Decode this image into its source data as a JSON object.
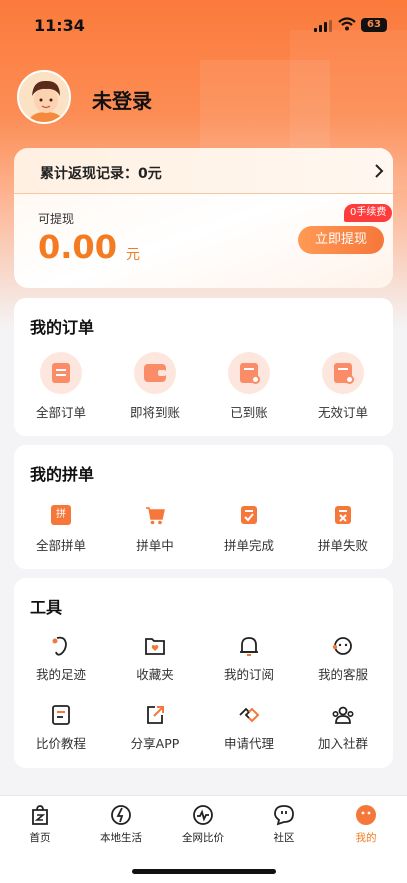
{
  "status_bar": {
    "time": "11:34",
    "battery": "63"
  },
  "user": {
    "name": "未登录"
  },
  "cashback": {
    "total_label": "累计返现记录：0元",
    "withdrawable_label": "可提现",
    "amount": "0.00",
    "unit": "元",
    "fee_badge": "0手续费",
    "withdraw_button": "立即提现"
  },
  "orders": {
    "title": "我的订单",
    "items": [
      {
        "label": "全部订单",
        "icon": "all-orders-icon"
      },
      {
        "label": "即将到账",
        "icon": "wallet-icon"
      },
      {
        "label": "已到账",
        "icon": "received-icon"
      },
      {
        "label": "无效订单",
        "icon": "invalid-order-icon"
      }
    ]
  },
  "pindan": {
    "title": "我的拼单",
    "items": [
      {
        "label": "全部拼单",
        "icon": "group-all-icon"
      },
      {
        "label": "拼单中",
        "icon": "cart-icon"
      },
      {
        "label": "拼单完成",
        "icon": "group-done-icon"
      },
      {
        "label": "拼单失败",
        "icon": "group-fail-icon"
      }
    ],
    "pin_glyph": "拼"
  },
  "tools": {
    "title": "工具",
    "items": [
      {
        "label": "我的足迹",
        "icon": "footprint-icon"
      },
      {
        "label": "收藏夹",
        "icon": "favorites-icon"
      },
      {
        "label": "我的订阅",
        "icon": "bell-icon"
      },
      {
        "label": "我的客服",
        "icon": "customer-service-icon"
      },
      {
        "label": "比价教程",
        "icon": "tutorial-icon"
      },
      {
        "label": "分享APP",
        "icon": "share-icon"
      },
      {
        "label": "申请代理",
        "icon": "handshake-icon"
      },
      {
        "label": "加入社群",
        "icon": "group-icon"
      }
    ]
  },
  "tabbar": {
    "items": [
      {
        "label": "首页",
        "icon": "home-icon"
      },
      {
        "label": "本地生活",
        "icon": "local-life-icon"
      },
      {
        "label": "全网比价",
        "icon": "compare-icon"
      },
      {
        "label": "社区",
        "icon": "community-icon"
      },
      {
        "label": "我的",
        "icon": "profile-icon"
      }
    ],
    "active": "我的"
  },
  "colors": {
    "accent": "#f47b22",
    "hero": "#fb7a3c",
    "badge": "#ff3c3c"
  }
}
